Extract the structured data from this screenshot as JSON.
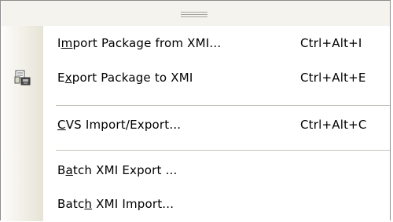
{
  "menu": {
    "items": [
      {
        "pre": "I",
        "key": "m",
        "post": "port Package from XMI...",
        "shortcut": "Ctrl+Alt+I"
      },
      {
        "pre": "E",
        "key": "x",
        "post": "port Package to XMI",
        "shortcut": "Ctrl+Alt+E"
      },
      {
        "pre": "",
        "key": "C",
        "post": "VS Import/Export...",
        "shortcut": "Ctrl+Alt+C"
      },
      {
        "pre": "B",
        "key": "a",
        "post": "tch XMI Export ...",
        "shortcut": ""
      },
      {
        "pre": "Batc",
        "key": "h",
        "post": " XMI Import...",
        "shortcut": ""
      }
    ],
    "icons": {
      "export_item_icon": "export-xmi-icon",
      "grip_icon": "drag-grip-icon"
    }
  }
}
